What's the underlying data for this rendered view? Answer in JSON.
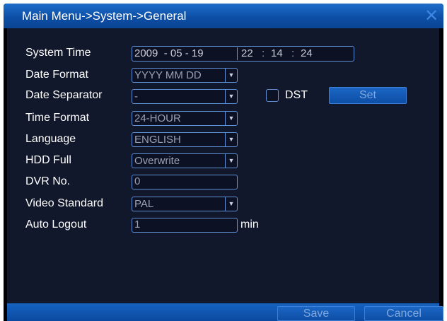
{
  "window": {
    "title": "Main Menu->System->General",
    "close_symbol": "✕"
  },
  "form": {
    "system_time": {
      "label": "System Time",
      "date": "2009  - 05 - 19",
      "hour": "22",
      "minute": "14",
      "second": "24",
      "time_sep": ":"
    },
    "date_format": {
      "label": "Date Format",
      "value": "YYYY MM DD"
    },
    "date_separator": {
      "label": "Date Separator",
      "value": "-"
    },
    "dst": {
      "label": "DST",
      "checked": false,
      "set_label": "Set"
    },
    "time_format": {
      "label": "Time Format",
      "value": "24-HOUR"
    },
    "language": {
      "label": "Language",
      "value": "ENGLISH"
    },
    "hdd_full": {
      "label": "HDD Full",
      "value": "Overwrite"
    },
    "dvr_no": {
      "label": "DVR No.",
      "value": "0"
    },
    "video_standard": {
      "label": "Video Standard",
      "value": "PAL"
    },
    "auto_logout": {
      "label": "Auto Logout",
      "value": "1",
      "unit": "min"
    }
  },
  "footer": {
    "save_label": "Save",
    "cancel_label": "Cancel"
  },
  "icons": {
    "dropdown": "chevron-down-icon",
    "close": "close-icon"
  },
  "colors": {
    "title_bar": "#0d4fa6",
    "panel_bg": "#11182b",
    "field_border": "#5f8fd4",
    "button_bg": "#1b66c4"
  }
}
